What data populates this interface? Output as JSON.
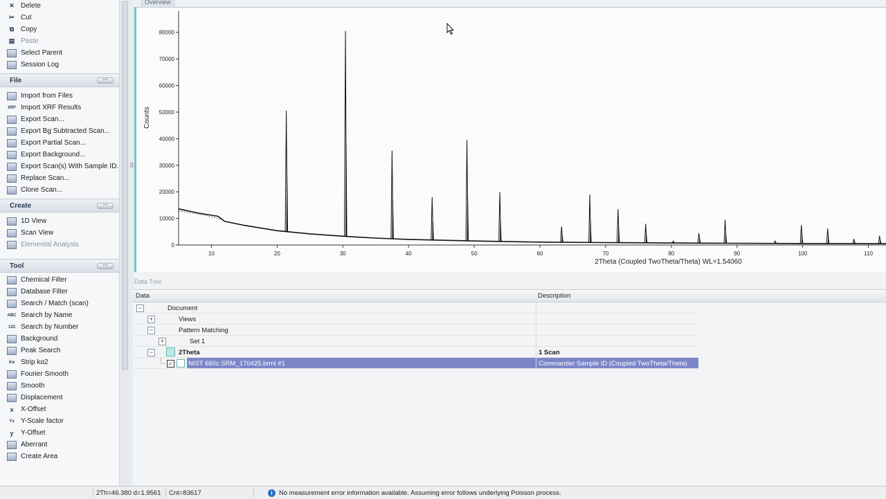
{
  "left_panel": {
    "edit_items": [
      {
        "label": "Delete",
        "icon": "delete-icon",
        "disabled": false
      },
      {
        "label": "Cut",
        "icon": "cut-icon",
        "disabled": false
      },
      {
        "label": "Copy",
        "icon": "copy-icon",
        "disabled": false
      },
      {
        "label": "Paste",
        "icon": "paste-icon",
        "disabled": true
      },
      {
        "label": "Select Parent",
        "icon": "select-parent-icon",
        "disabled": false
      },
      {
        "label": "Session Log",
        "icon": "session-log-icon",
        "disabled": false
      }
    ],
    "file": {
      "title": "File",
      "items": [
        {
          "label": "Import from Files",
          "icon": "import-files-icon",
          "disabled": false
        },
        {
          "label": "Import XRF Results",
          "icon": "import-xrf-icon",
          "disabled": false
        },
        {
          "label": "Export Scan...",
          "icon": "export-scan-icon",
          "disabled": false
        },
        {
          "label": "Export Bg Subtracted Scan...",
          "icon": "export-bg-subtracted-icon",
          "disabled": false
        },
        {
          "label": "Export Partial Scan...",
          "icon": "export-partial-icon",
          "disabled": false
        },
        {
          "label": "Export Background...",
          "icon": "export-background-icon",
          "disabled": false
        },
        {
          "label": "Export Scan(s) With Sample ID...",
          "icon": "export-sample-id-icon",
          "disabled": false
        },
        {
          "label": "Replace Scan...",
          "icon": "replace-scan-icon",
          "disabled": false
        },
        {
          "label": "Clone Scan...",
          "icon": "clone-scan-icon",
          "disabled": false
        }
      ]
    },
    "create": {
      "title": "Create",
      "items": [
        {
          "label": "1D View",
          "icon": "1d-view-icon",
          "disabled": false
        },
        {
          "label": "Scan View",
          "icon": "scan-view-icon",
          "disabled": false
        },
        {
          "label": "Elemental Analysis",
          "icon": "elemental-analysis-icon",
          "disabled": true
        }
      ]
    },
    "tool": {
      "title": "Tool",
      "items": [
        {
          "label": "Chemical Filter",
          "icon": "chemical-filter-icon",
          "disabled": false
        },
        {
          "label": "Database Filter",
          "icon": "database-filter-icon",
          "disabled": false
        },
        {
          "label": "Search / Match (scan)",
          "icon": "search-match-icon",
          "disabled": false
        },
        {
          "label": "Search by Name",
          "icon": "search-name-icon",
          "disabled": false
        },
        {
          "label": "Search by Number",
          "icon": "search-number-icon",
          "disabled": false
        },
        {
          "label": "Background",
          "icon": "background-icon",
          "disabled": false
        },
        {
          "label": "Peak Search",
          "icon": "peak-search-icon",
          "disabled": false
        },
        {
          "label": "Strip kα2",
          "icon": "strip-ka2-icon",
          "disabled": false
        },
        {
          "label": "Fourier Smooth",
          "icon": "fourier-smooth-icon",
          "disabled": false
        },
        {
          "label": "Smooth",
          "icon": "smooth-icon",
          "disabled": false
        },
        {
          "label": "Displacement",
          "icon": "displacement-icon",
          "disabled": false
        },
        {
          "label": "X-Offset",
          "icon": "x-offset-icon",
          "disabled": false
        },
        {
          "label": "Y-Scale factor",
          "icon": "y-scale-icon",
          "disabled": false
        },
        {
          "label": "Y-Offset",
          "icon": "y-offset-icon",
          "disabled": false
        },
        {
          "label": "Aberrant",
          "icon": "aberrant-icon",
          "disabled": false
        },
        {
          "label": "Create Area",
          "icon": "create-area-icon",
          "disabled": false
        }
      ]
    },
    "section_menu_glyph": "⋯"
  },
  "overview": {
    "tab_title": "Overview"
  },
  "chart_data": {
    "type": "line",
    "title": "",
    "xlabel": "2Theta (Coupled TwoTheta/Theta) WL=1.54060",
    "ylabel": "Counts",
    "xlim": [
      5,
      113
    ],
    "ylim": [
      0,
      88000
    ],
    "xticks": [
      10,
      20,
      30,
      40,
      50,
      60,
      70,
      80,
      90,
      100,
      110
    ],
    "yticks": [
      0,
      10000,
      20000,
      30000,
      40000,
      50000,
      60000,
      70000,
      80000
    ],
    "grid": false,
    "background": [
      [
        5,
        13600
      ],
      [
        8,
        12000
      ],
      [
        11,
        10800
      ],
      [
        12,
        8900
      ],
      [
        15,
        7400
      ],
      [
        20,
        5400
      ],
      [
        25,
        4200
      ],
      [
        30,
        3300
      ],
      [
        35,
        2600
      ],
      [
        40,
        2100
      ],
      [
        45,
        1800
      ],
      [
        50,
        1500
      ],
      [
        60,
        1100
      ],
      [
        70,
        900
      ],
      [
        80,
        750
      ],
      [
        90,
        650
      ],
      [
        100,
        550
      ],
      [
        113,
        500
      ]
    ],
    "peaks": [
      {
        "x": 21.4,
        "y": 50500
      },
      {
        "x": 30.4,
        "y": 80500
      },
      {
        "x": 37.5,
        "y": 35500
      },
      {
        "x": 43.6,
        "y": 18000
      },
      {
        "x": 48.9,
        "y": 39500
      },
      {
        "x": 53.9,
        "y": 20000
      },
      {
        "x": 63.3,
        "y": 7000
      },
      {
        "x": 67.6,
        "y": 19000
      },
      {
        "x": 71.9,
        "y": 13500
      },
      {
        "x": 76.1,
        "y": 8000
      },
      {
        "x": 80.3,
        "y": 1500
      },
      {
        "x": 84.2,
        "y": 4500
      },
      {
        "x": 88.2,
        "y": 9500
      },
      {
        "x": 95.8,
        "y": 1500
      },
      {
        "x": 99.8,
        "y": 7500
      },
      {
        "x": 103.8,
        "y": 6200
      },
      {
        "x": 107.8,
        "y": 2300
      },
      {
        "x": 111.7,
        "y": 3500
      }
    ],
    "line_color": "#111111"
  },
  "data_tree": {
    "label": "Data Tree",
    "columns": [
      "Data",
      "Description"
    ],
    "rows": [
      {
        "label": "Document",
        "description": "",
        "expander": "−",
        "level": 0,
        "bold": false,
        "selected": false
      },
      {
        "label": "Views",
        "description": "",
        "expander": "+",
        "level": 1,
        "bold": false,
        "selected": false
      },
      {
        "label": "Pattern Matching",
        "description": "",
        "expander": "−",
        "level": 1,
        "bold": false,
        "selected": false
      },
      {
        "label": "Set 1",
        "description": "",
        "expander": "+",
        "level": 2,
        "bold": false,
        "selected": false
      },
      {
        "label": "2Theta",
        "description": "1 Scan",
        "expander": "−",
        "level": 1,
        "bold": true,
        "selected": false
      },
      {
        "label": "NIST 660c SRM_170425.brml #1",
        "description": "Commander Sample ID (Coupled TwoTheta/Theta)",
        "expander": "",
        "level": 2,
        "bold": false,
        "selected": true
      }
    ]
  },
  "status_bar": {
    "position": "2Th=46.380  d=1.9561",
    "count": "Cnt=83617",
    "message": "No measurement error information available. Assuming error follows underlying Poisson process."
  },
  "colors": {
    "accent": "#6fc7c2",
    "selection": "#7b86c9",
    "selection_text": "#ffffff"
  }
}
